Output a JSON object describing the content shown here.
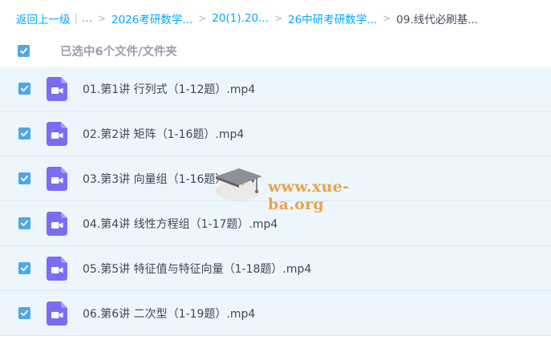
{
  "breadcrumb": {
    "back": "返回上一级",
    "sep_bar": "|",
    "ellipsis": "...",
    "items": [
      "2026考研数学...",
      "20(1).20...",
      "26中研考研数学..."
    ],
    "current": "09.线代必刷基..."
  },
  "selection": {
    "text": "已选中6个文件/文件夹",
    "checked": true
  },
  "files": [
    {
      "name": "01.第1讲 行列式（1-12题）.mp4",
      "checked": true,
      "icon": "video-file-icon"
    },
    {
      "name": "02.第2讲 矩阵（1-16题）.mp4",
      "checked": true,
      "icon": "video-file-icon"
    },
    {
      "name": "03.第3讲 向量组（1-16题）.mp4",
      "checked": true,
      "icon": "video-file-icon"
    },
    {
      "name": "04.第4讲 线性方程组（1-17题）.mp4",
      "checked": true,
      "icon": "video-file-icon"
    },
    {
      "name": "05.第5讲 特征值与特征向量（1-18题）.mp4",
      "checked": true,
      "icon": "video-file-icon"
    },
    {
      "name": "06.第6讲 二次型（1-19题）.mp4",
      "checked": true,
      "icon": "video-file-icon"
    }
  ],
  "watermark": {
    "text": "www.xue-ba.org"
  },
  "colors": {
    "link": "#06a7ff",
    "checkbox": "#4fa8e6",
    "row_bg": "#eef6fd",
    "video_icon": "#7a6cf3",
    "watermark": "#e7a44a"
  }
}
